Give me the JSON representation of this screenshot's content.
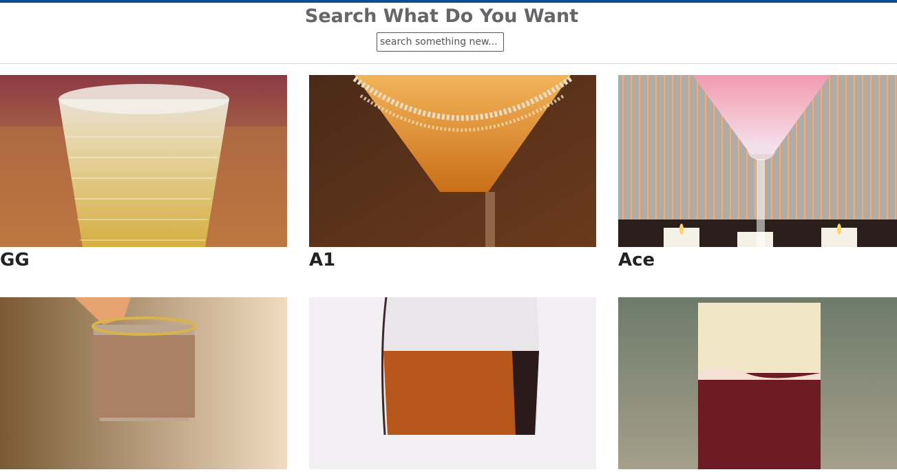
{
  "header": {
    "title": "Search What Do You Want",
    "search_placeholder": "search something new..."
  },
  "drinks": [
    {
      "name": "GG"
    },
    {
      "name": "A1"
    },
    {
      "name": "Ace"
    },
    {
      "name": ""
    },
    {
      "name": ""
    },
    {
      "name": ""
    }
  ],
  "colors": {
    "accent_bar": "#0f4d92",
    "title_text": "#666666",
    "card_title_text": "#222222"
  }
}
